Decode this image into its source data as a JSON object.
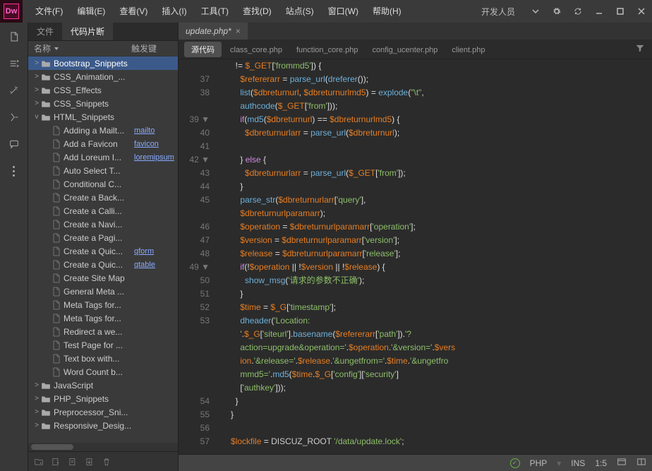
{
  "logo": "Dw",
  "menubar": [
    "文件(F)",
    "编辑(E)",
    "查看(V)",
    "插入(I)",
    "工具(T)",
    "查找(D)",
    "站点(S)",
    "窗口(W)",
    "帮助(H)"
  ],
  "title_right_label": "开发人员",
  "panel_tabs": {
    "file": "文件",
    "snippets": "代码片断"
  },
  "panel_header": {
    "name": "名称",
    "trigger": "触发键"
  },
  "tree": [
    {
      "depth": 0,
      "kind": "folder",
      "exp": ">",
      "label": "Bootstrap_Snippets",
      "selected": true
    },
    {
      "depth": 0,
      "kind": "folder",
      "exp": ">",
      "label": "CSS_Animation_..."
    },
    {
      "depth": 0,
      "kind": "folder",
      "exp": ">",
      "label": "CSS_Effects"
    },
    {
      "depth": 0,
      "kind": "folder",
      "exp": ">",
      "label": "CSS_Snippets"
    },
    {
      "depth": 0,
      "kind": "folder",
      "exp": "v",
      "label": "HTML_Snippets"
    },
    {
      "depth": 1,
      "kind": "file",
      "label": "Adding a Mailt...",
      "trigger": "mailto"
    },
    {
      "depth": 1,
      "kind": "file",
      "label": "Add a Favicon",
      "trigger": "favicon"
    },
    {
      "depth": 1,
      "kind": "file",
      "label": "Add Loreum I...",
      "trigger": "loremipsum"
    },
    {
      "depth": 1,
      "kind": "file",
      "label": "Auto Select T..."
    },
    {
      "depth": 1,
      "kind": "file",
      "label": "Conditional C..."
    },
    {
      "depth": 1,
      "kind": "file",
      "label": "Create a Back..."
    },
    {
      "depth": 1,
      "kind": "file",
      "label": "Create a Calli..."
    },
    {
      "depth": 1,
      "kind": "file",
      "label": "Create a Navi..."
    },
    {
      "depth": 1,
      "kind": "file",
      "label": "Create a Pagi..."
    },
    {
      "depth": 1,
      "kind": "file",
      "label": "Create a Quic...",
      "trigger": "qform"
    },
    {
      "depth": 1,
      "kind": "file",
      "label": "Create a Quic...",
      "trigger": "qtable"
    },
    {
      "depth": 1,
      "kind": "file",
      "label": "Create Site Map"
    },
    {
      "depth": 1,
      "kind": "file",
      "label": "General Meta ..."
    },
    {
      "depth": 1,
      "kind": "file",
      "label": "Meta Tags for..."
    },
    {
      "depth": 1,
      "kind": "file",
      "label": "Meta Tags for..."
    },
    {
      "depth": 1,
      "kind": "file",
      "label": "Redirect a we..."
    },
    {
      "depth": 1,
      "kind": "file",
      "label": "Test Page for ..."
    },
    {
      "depth": 1,
      "kind": "file",
      "label": "Text box with..."
    },
    {
      "depth": 1,
      "kind": "file",
      "label": "Word Count b..."
    },
    {
      "depth": 0,
      "kind": "folder",
      "exp": ">",
      "label": "JavaScript"
    },
    {
      "depth": 0,
      "kind": "folder",
      "exp": ">",
      "label": "PHP_Snippets"
    },
    {
      "depth": 0,
      "kind": "folder",
      "exp": ">",
      "label": "Preprocessor_Sni..."
    },
    {
      "depth": 0,
      "kind": "folder",
      "exp": ">",
      "label": "Responsive_Desig..."
    }
  ],
  "file_tab": "update.php*",
  "view_tabs": {
    "active": "源代码",
    "items": [
      "class_core.php",
      "function_core.php",
      "config_ucenter.php",
      "client.php"
    ]
  },
  "gutter_lines": [
    "",
    "37",
    "38",
    "",
    "39 ▼",
    "40",
    "41",
    "42 ▼",
    "43",
    "44",
    "45",
    "",
    "46",
    "47",
    "48",
    "49 ▼",
    "50",
    "51",
    "52",
    "53",
    "",
    "",
    "",
    "",
    "",
    "54",
    "55",
    "56",
    "57"
  ],
  "code_lines": [
    {
      "i": 0,
      "html": "        <span class='op'>!=</span> <span class='var'>$_GET</span><span class='brace'>[</span><span class='str'>'frommd5'</span><span class='brace'>]) {</span>"
    },
    {
      "i": 1,
      "html": "          <span class='var'>$refererarr</span> <span class='op'>=</span> <span class='fn'>parse_url</span><span class='brace'>(</span><span class='fn'>dreferer</span><span class='brace'>());</span>"
    },
    {
      "i": 2,
      "html": "          <span class='fn'>list</span><span class='brace'>(</span><span class='var'>$dbreturnurl</span><span class='op'>,</span> <span class='var'>$dbreturnurlmd5</span><span class='brace'>)</span> <span class='op'>=</span> <span class='fn'>explode</span><span class='brace'>(</span><span class='str'>\"\\t\"</span><span class='op'>,</span>"
    },
    {
      "i": 3,
      "html": "          <span class='fn'>authcode</span><span class='brace'>(</span><span class='var'>$_GET</span><span class='brace'>[</span><span class='str'>'from'</span><span class='brace'>]));</span>"
    },
    {
      "i": 4,
      "html": "          <span class='kw'>if</span><span class='brace'>(</span><span class='fn'>md5</span><span class='brace'>(</span><span class='var'>$dbreturnurl</span><span class='brace'>)</span> <span class='op'>==</span> <span class='var'>$dbreturnurlmd5</span><span class='brace'>) {</span>"
    },
    {
      "i": 5,
      "html": "            <span class='var'>$dbreturnurlarr</span> <span class='op'>=</span> <span class='fn'>parse_url</span><span class='brace'>(</span><span class='var'>$dbreturnurl</span><span class='brace'>);</span>"
    },
    {
      "i": 6,
      "html": ""
    },
    {
      "i": 7,
      "html": "          <span class='brace'>}</span> <span class='kw'>else</span> <span class='brace'>{</span>"
    },
    {
      "i": 8,
      "html": "            <span class='var'>$dbreturnurlarr</span> <span class='op'>=</span> <span class='fn'>parse_url</span><span class='brace'>(</span><span class='var'>$_GET</span><span class='brace'>[</span><span class='str'>'from'</span><span class='brace'>]);</span>"
    },
    {
      "i": 9,
      "html": "          <span class='brace'>}</span>"
    },
    {
      "i": 10,
      "html": "          <span class='fn'>parse_str</span><span class='brace'>(</span><span class='var'>$dbreturnurlarr</span><span class='brace'>[</span><span class='str'>'query'</span><span class='brace'>],</span>"
    },
    {
      "i": 11,
      "html": "          <span class='var'>$dbreturnurlparamarr</span><span class='brace'>);</span>"
    },
    {
      "i": 12,
      "html": "          <span class='var'>$operation</span> <span class='op'>=</span> <span class='var'>$dbreturnurlparamarr</span><span class='brace'>[</span><span class='str'>'operation'</span><span class='brace'>];</span>"
    },
    {
      "i": 13,
      "html": "          <span class='var'>$version</span> <span class='op'>=</span> <span class='var'>$dbreturnurlparamarr</span><span class='brace'>[</span><span class='str'>'version'</span><span class='brace'>];</span>"
    },
    {
      "i": 14,
      "html": "          <span class='var'>$release</span> <span class='op'>=</span> <span class='var'>$dbreturnurlparamarr</span><span class='brace'>[</span><span class='str'>'release'</span><span class='brace'>];</span>"
    },
    {
      "i": 15,
      "html": "          <span class='kw'>if</span><span class='brace'>(</span><span class='op'>!</span><span class='var'>$operation</span> <span class='op'>||</span> <span class='op'>!</span><span class='var'>$version</span> <span class='op'>||</span> <span class='op'>!</span><span class='var'>$release</span><span class='brace'>) {</span>"
    },
    {
      "i": 16,
      "html": "            <span class='fn'>show_msg</span><span class='brace'>(</span><span class='str'>'请求的参数不正确'</span><span class='brace'>);</span>"
    },
    {
      "i": 17,
      "html": "          <span class='brace'>}</span>"
    },
    {
      "i": 18,
      "html": "          <span class='var'>$time</span> <span class='op'>=</span> <span class='var'>$_G</span><span class='brace'>[</span><span class='str'>'timestamp'</span><span class='brace'>];</span>"
    },
    {
      "i": 19,
      "html": "          <span class='fn'>dheader</span><span class='brace'>(</span><span class='str'>'Location:</span>"
    },
    {
      "i": 20,
      "html": "          <span class='str'>'</span><span class='op'>.</span><span class='var'>$_G</span><span class='brace'>[</span><span class='str'>'siteurl'</span><span class='brace'>]</span><span class='op'>.</span><span class='fn'>basename</span><span class='brace'>(</span><span class='var'>$refererarr</span><span class='brace'>[</span><span class='str'>'path'</span><span class='brace'>])</span><span class='op'>.</span><span class='str'>'?</span>"
    },
    {
      "i": 21,
      "html": "          <span class='str'>action=upgrade&operation='</span><span class='op'>.</span><span class='var'>$operation</span><span class='op'>.</span><span class='str'>'&version='</span><span class='op'>.</span><span class='var'>$vers</span>"
    },
    {
      "i": 22,
      "html": "          <span class='var'>ion</span><span class='op'>.</span><span class='str'>'&release='</span><span class='op'>.</span><span class='var'>$release</span><span class='op'>.</span><span class='str'>'&ungetfrom='</span><span class='op'>.</span><span class='var'>$time</span><span class='op'>.</span><span class='str'>'&ungetfro</span>"
    },
    {
      "i": 23,
      "html": "          <span class='str'>mmd5='</span><span class='op'>.</span><span class='fn'>md5</span><span class='brace'>(</span><span class='var'>$time</span><span class='op'>.</span><span class='var'>$_G</span><span class='brace'>[</span><span class='str'>'config'</span><span class='brace'>][</span><span class='str'>'security'</span><span class='brace'>]</span>"
    },
    {
      "i": 24,
      "html": "          <span class='brace'>[</span><span class='str'>'authkey'</span><span class='brace'>]));</span>"
    },
    {
      "i": 25,
      "html": "        <span class='brace'>}</span>"
    },
    {
      "i": 26,
      "html": "      <span class='brace'>}</span>"
    },
    {
      "i": 27,
      "html": ""
    },
    {
      "i": 28,
      "html": "      <span class='var'>$lockfile</span> <span class='op'>=</span> DISCUZ_ROOT <span class='str'>'/data/update.lock'</span><span class='op'>;</span>"
    }
  ],
  "statusbar": {
    "lang": "PHP",
    "mode": "INS",
    "pos": "1:5"
  }
}
